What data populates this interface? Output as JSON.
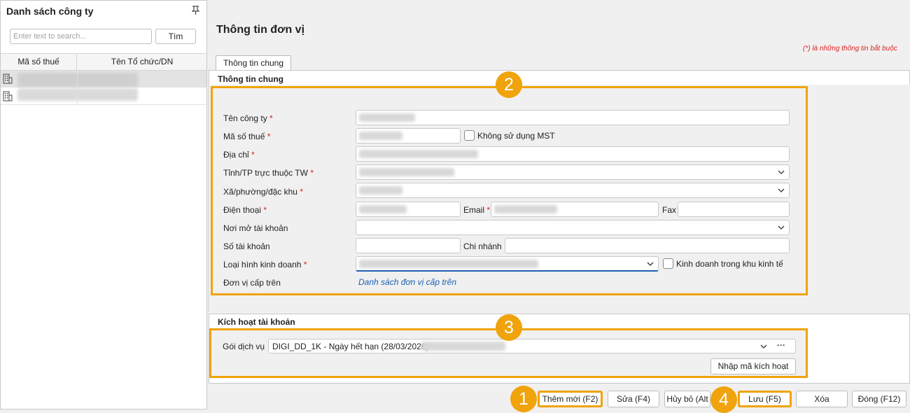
{
  "sidebar": {
    "title": "Danh sách công ty",
    "search_placeholder": "Enter text to search...",
    "search_button": "Tìm",
    "columns": [
      "Mã số thuế",
      "Tên Tổ chức/DN"
    ]
  },
  "main": {
    "title": "Thông tin đơn vị",
    "required_note": "(*)  là những thông tin bắt buộc",
    "tab": "Thông tin chung",
    "section_general": "Thông tin chung",
    "labels": {
      "company_name": "Tên công ty",
      "tax_code": "Mã số thuế",
      "no_tax_code": "Không sử dụng MST",
      "address": "Địa chỉ",
      "province": "Tỉnh/TP trực thuộc TW",
      "ward": "Xã/phường/đặc khu",
      "phone": "Điện thoại",
      "email": "Email",
      "fax": "Fax",
      "bank_place": "Nơi mở tài khoản",
      "account_no": "Số tài khoản",
      "branch": "Chi nhánh",
      "business_type": "Loại hình kinh doanh",
      "economic_zone": "Kinh doanh trong khu kinh tế",
      "parent_unit": "Đơn vị cấp trên"
    },
    "required_mark": "*",
    "parent_link": "Danh sách đơn vị cấp trên",
    "section_activation": "Kích hoạt tài khoản",
    "package_label": "Gói dịch vụ",
    "package_value": "DIGI_DD_1K - Ngày hết hạn (28/03/2026) -",
    "more_glyph": "···",
    "activate_code_button": "Nhập mã kích hoạt"
  },
  "buttons": {
    "add": "Thêm mới (F2)",
    "edit": "Sửa (F4)",
    "cancel": "Hủy bỏ (Alt",
    "save": "Lưu (F5)",
    "delete": "Xóa",
    "close": "Đóng (F12)"
  },
  "badges": [
    "1",
    "2",
    "3",
    "4"
  ],
  "colors": {
    "highlight": "#f0a30a",
    "required": "#e02020",
    "link": "#1a5fb4"
  }
}
